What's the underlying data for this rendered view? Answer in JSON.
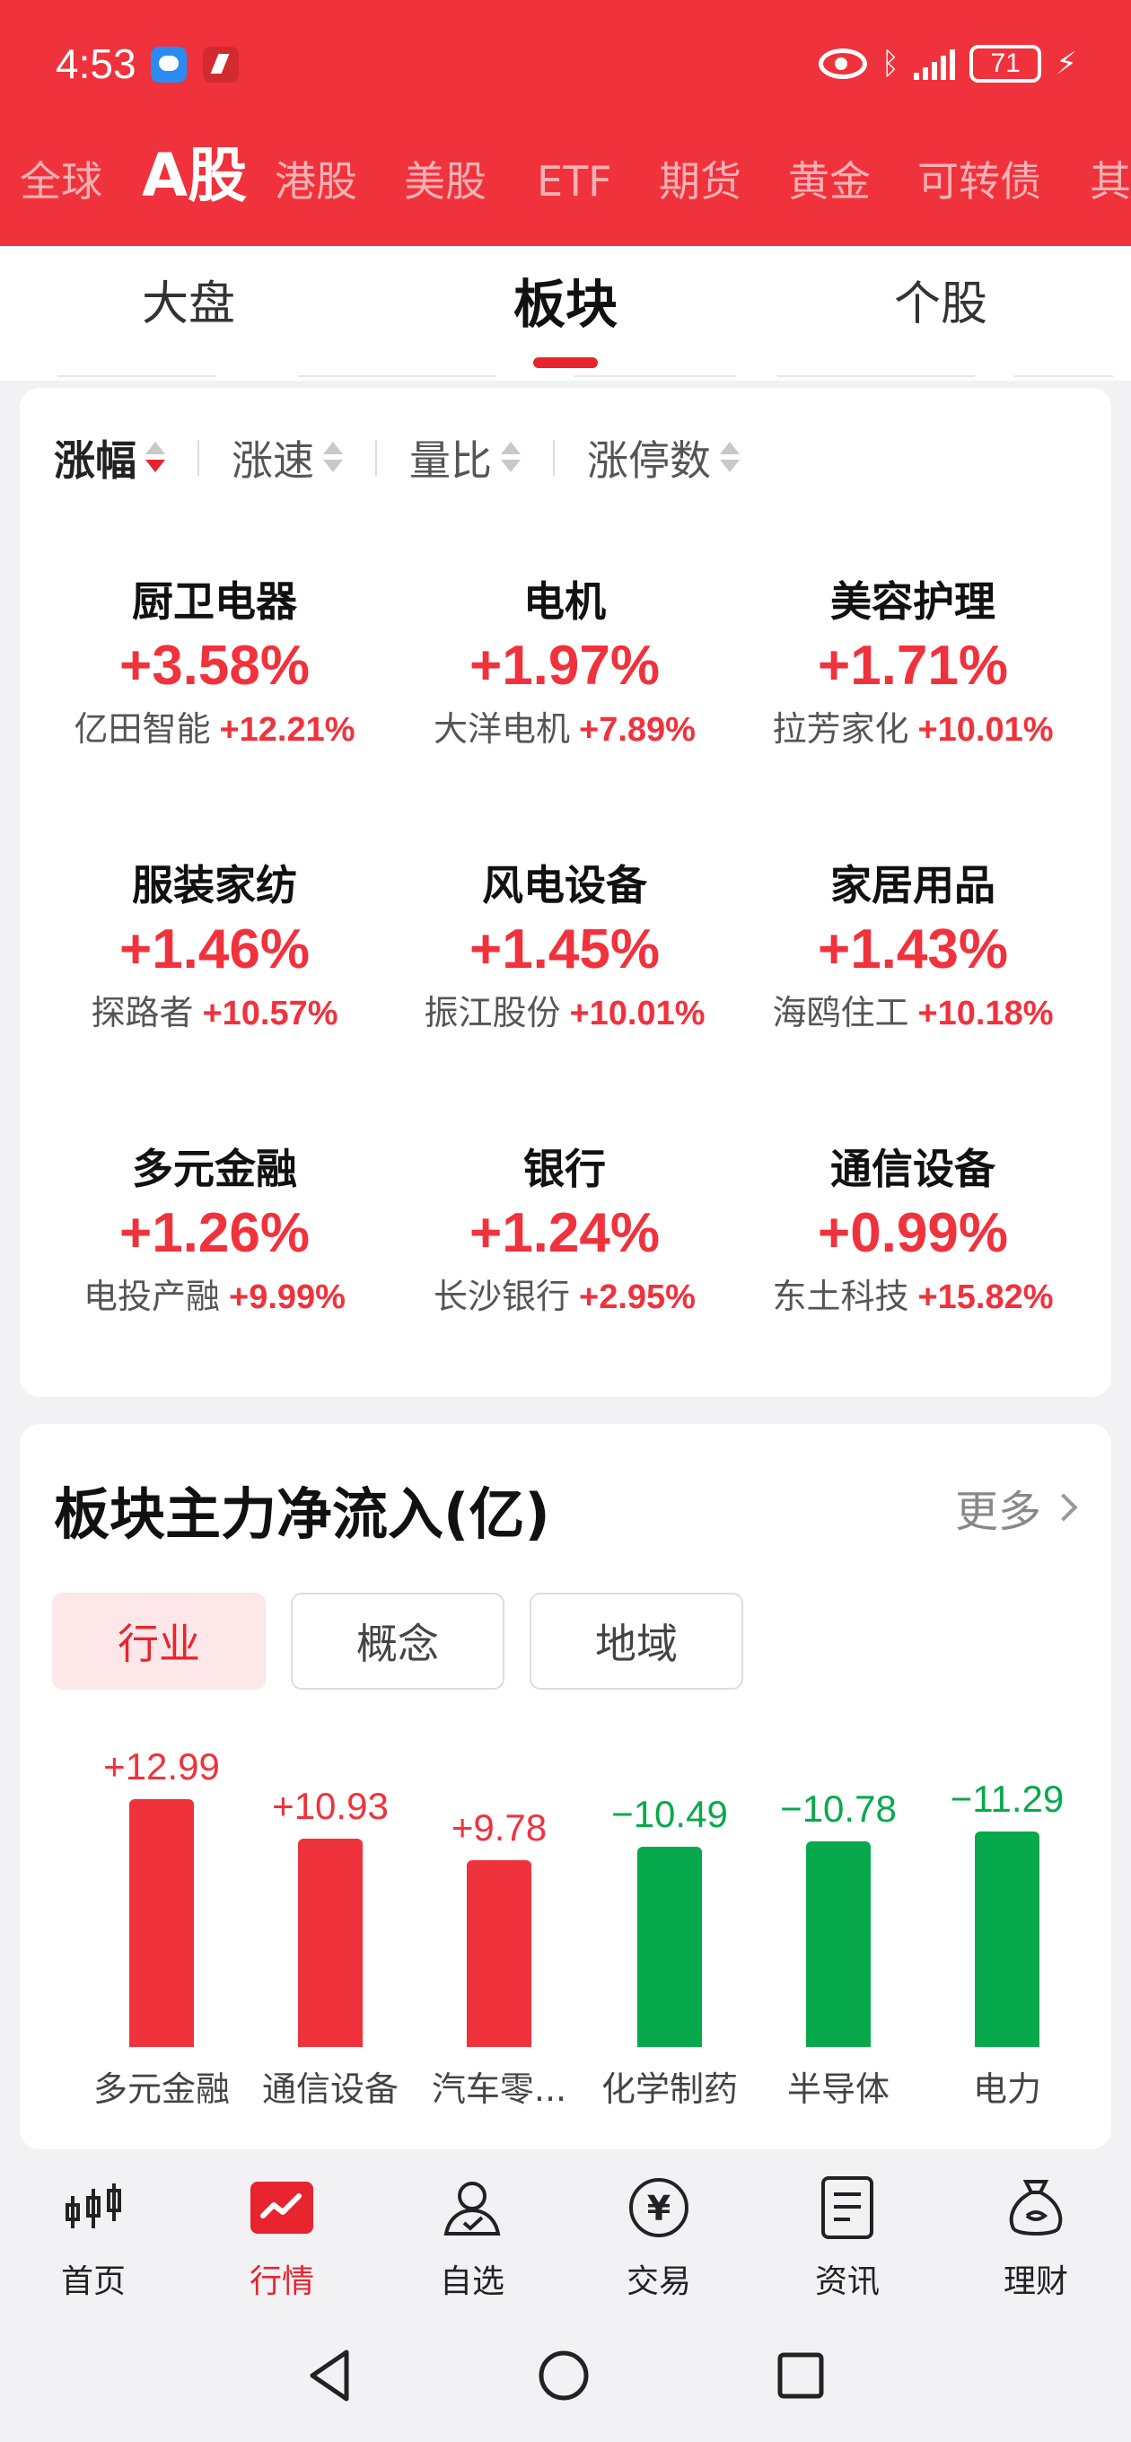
{
  "status_bar": {
    "time": "4:53",
    "battery": "71"
  },
  "market_tabs": [
    "全球",
    "A股",
    "港股",
    "美股",
    "ETF",
    "期货",
    "黄金",
    "可转债",
    "其"
  ],
  "sub_tabs": [
    "大盘",
    "板块",
    "个股"
  ],
  "sort_options": [
    "涨幅",
    "涨速",
    "量比",
    "涨停数"
  ],
  "sectors": [
    {
      "name": "厨卫电器",
      "change": "+3.58%",
      "lead_name": "亿田智能",
      "lead_change": "+12.21%"
    },
    {
      "name": "电机",
      "change": "+1.97%",
      "lead_name": "大洋电机",
      "lead_change": "+7.89%"
    },
    {
      "name": "美容护理",
      "change": "+1.71%",
      "lead_name": "拉芳家化",
      "lead_change": "+10.01%"
    },
    {
      "name": "服装家纺",
      "change": "+1.46%",
      "lead_name": "探路者",
      "lead_change": "+10.57%"
    },
    {
      "name": "风电设备",
      "change": "+1.45%",
      "lead_name": "振江股份",
      "lead_change": "+10.01%"
    },
    {
      "name": "家居用品",
      "change": "+1.43%",
      "lead_name": "海鸥住工",
      "lead_change": "+10.18%"
    },
    {
      "name": "多元金融",
      "change": "+1.26%",
      "lead_name": "电投产融",
      "lead_change": "+9.99%"
    },
    {
      "name": "银行",
      "change": "+1.24%",
      "lead_name": "长沙银行",
      "lead_change": "+2.95%"
    },
    {
      "name": "通信设备",
      "change": "+0.99%",
      "lead_name": "东土科技",
      "lead_change": "+15.82%"
    }
  ],
  "flow": {
    "title": "板块主力净流入(亿)",
    "more": "更多",
    "tabs": [
      "行业",
      "概念",
      "地域"
    ]
  },
  "chart_data": {
    "type": "bar",
    "categories": [
      "多元金融",
      "通信设备",
      "汽车零...",
      "化学制药",
      "半导体",
      "电力"
    ],
    "values": [
      12.99,
      10.93,
      9.78,
      -10.49,
      -10.78,
      -11.29
    ],
    "labels": [
      "+12.99",
      "+10.93",
      "+9.78",
      "−10.49",
      "−10.78",
      "−11.29"
    ],
    "colors": {
      "positive": "#f0323c",
      "negative": "#08a94c"
    }
  },
  "bottom_nav": [
    "首页",
    "行情",
    "自选",
    "交易",
    "资讯",
    "理财"
  ],
  "colors": {
    "brand_red": "#f0323c",
    "accent_red": "#e8242f",
    "green": "#08a94c"
  }
}
